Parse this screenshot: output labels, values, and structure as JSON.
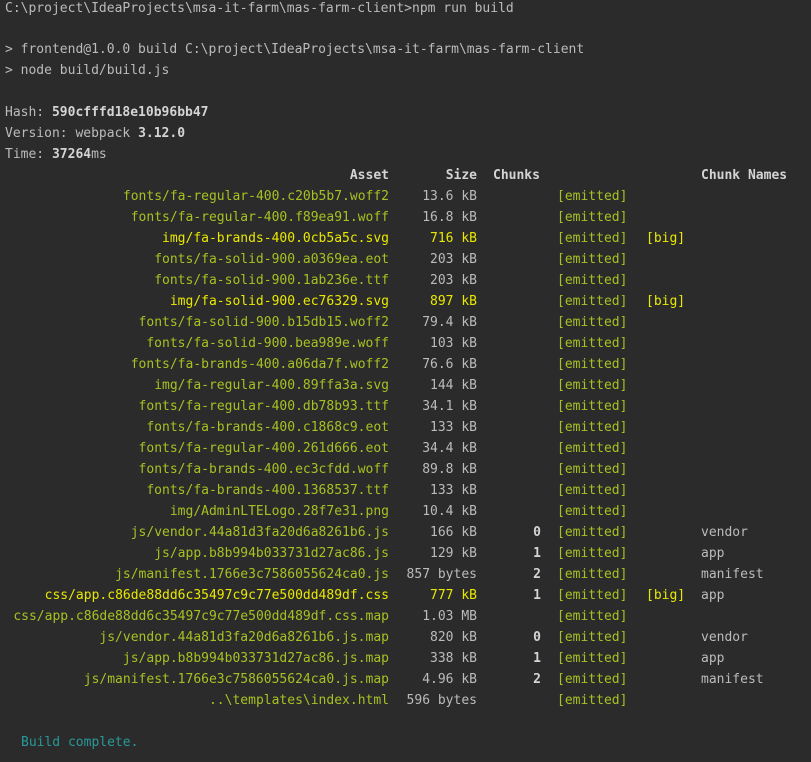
{
  "terminal": {
    "prompt_line": "C:\\project\\IdeaProjects\\msa-it-farm\\mas-farm-client>npm run build",
    "script_line": "> frontend@1.0.0 build C:\\project\\IdeaProjects\\msa-it-farm\\mas-farm-client",
    "node_line": "> node build/build.js",
    "hash_label": "Hash: ",
    "hash_value": "590cfffd18e10b96bb47",
    "version_label": "Version: webpack ",
    "version_value": "3.12.0",
    "time_label": "Time: ",
    "time_value": "37264",
    "time_unit": "ms",
    "build_complete": "Build complete."
  },
  "table": {
    "headers": {
      "asset": "Asset",
      "size": "Size",
      "chunks": "Chunks",
      "chunk_names": "Chunk Names"
    },
    "rows": [
      {
        "asset": "fonts/fa-regular-400.c20b5b7.woff2",
        "size": "13.6 kB",
        "chunks": "",
        "emitted": "[emitted]",
        "big": "",
        "names": "",
        "highlight": false
      },
      {
        "asset": "fonts/fa-regular-400.f89ea91.woff",
        "size": "16.8 kB",
        "chunks": "",
        "emitted": "[emitted]",
        "big": "",
        "names": "",
        "highlight": false
      },
      {
        "asset": "img/fa-brands-400.0cb5a5c.svg",
        "size": "716 kB",
        "chunks": "",
        "emitted": "[emitted]",
        "big": "[big]",
        "names": "",
        "highlight": true
      },
      {
        "asset": "fonts/fa-solid-900.a0369ea.eot",
        "size": "203 kB",
        "chunks": "",
        "emitted": "[emitted]",
        "big": "",
        "names": "",
        "highlight": false
      },
      {
        "asset": "fonts/fa-solid-900.1ab236e.ttf",
        "size": "203 kB",
        "chunks": "",
        "emitted": "[emitted]",
        "big": "",
        "names": "",
        "highlight": false
      },
      {
        "asset": "img/fa-solid-900.ec76329.svg",
        "size": "897 kB",
        "chunks": "",
        "emitted": "[emitted]",
        "big": "[big]",
        "names": "",
        "highlight": true
      },
      {
        "asset": "fonts/fa-solid-900.b15db15.woff2",
        "size": "79.4 kB",
        "chunks": "",
        "emitted": "[emitted]",
        "big": "",
        "names": "",
        "highlight": false
      },
      {
        "asset": "fonts/fa-solid-900.bea989e.woff",
        "size": "103 kB",
        "chunks": "",
        "emitted": "[emitted]",
        "big": "",
        "names": "",
        "highlight": false
      },
      {
        "asset": "fonts/fa-brands-400.a06da7f.woff2",
        "size": "76.6 kB",
        "chunks": "",
        "emitted": "[emitted]",
        "big": "",
        "names": "",
        "highlight": false
      },
      {
        "asset": "img/fa-regular-400.89ffa3a.svg",
        "size": "144 kB",
        "chunks": "",
        "emitted": "[emitted]",
        "big": "",
        "names": "",
        "highlight": false
      },
      {
        "asset": "fonts/fa-regular-400.db78b93.ttf",
        "size": "34.1 kB",
        "chunks": "",
        "emitted": "[emitted]",
        "big": "",
        "names": "",
        "highlight": false
      },
      {
        "asset": "fonts/fa-brands-400.c1868c9.eot",
        "size": "133 kB",
        "chunks": "",
        "emitted": "[emitted]",
        "big": "",
        "names": "",
        "highlight": false
      },
      {
        "asset": "fonts/fa-regular-400.261d666.eot",
        "size": "34.4 kB",
        "chunks": "",
        "emitted": "[emitted]",
        "big": "",
        "names": "",
        "highlight": false
      },
      {
        "asset": "fonts/fa-brands-400.ec3cfdd.woff",
        "size": "89.8 kB",
        "chunks": "",
        "emitted": "[emitted]",
        "big": "",
        "names": "",
        "highlight": false
      },
      {
        "asset": "fonts/fa-brands-400.1368537.ttf",
        "size": "133 kB",
        "chunks": "",
        "emitted": "[emitted]",
        "big": "",
        "names": "",
        "highlight": false
      },
      {
        "asset": "img/AdminLTELogo.28f7e31.png",
        "size": "10.4 kB",
        "chunks": "",
        "emitted": "[emitted]",
        "big": "",
        "names": "",
        "highlight": false
      },
      {
        "asset": "js/vendor.44a81d3fa20d6a8261b6.js",
        "size": "166 kB",
        "chunks": "0",
        "emitted": "[emitted]",
        "big": "",
        "names": "vendor",
        "highlight": false
      },
      {
        "asset": "js/app.b8b994b033731d27ac86.js",
        "size": "129 kB",
        "chunks": "1",
        "emitted": "[emitted]",
        "big": "",
        "names": "app",
        "highlight": false
      },
      {
        "asset": "js/manifest.1766e3c7586055624ca0.js",
        "size": "857 bytes",
        "chunks": "2",
        "emitted": "[emitted]",
        "big": "",
        "names": "manifest",
        "highlight": false
      },
      {
        "asset": "css/app.c86de88dd6c35497c9c77e500dd489df.css",
        "size": "777 kB",
        "chunks": "1",
        "emitted": "[emitted]",
        "big": "[big]",
        "names": "app",
        "highlight": true
      },
      {
        "asset": "css/app.c86de88dd6c35497c9c77e500dd489df.css.map",
        "size": "1.03 MB",
        "chunks": "",
        "emitted": "[emitted]",
        "big": "",
        "names": "",
        "highlight": false
      },
      {
        "asset": "js/vendor.44a81d3fa20d6a8261b6.js.map",
        "size": "820 kB",
        "chunks": "0",
        "emitted": "[emitted]",
        "big": "",
        "names": "vendor",
        "highlight": false
      },
      {
        "asset": "js/app.b8b994b033731d27ac86.js.map",
        "size": "338 kB",
        "chunks": "1",
        "emitted": "[emitted]",
        "big": "",
        "names": "app",
        "highlight": false
      },
      {
        "asset": "js/manifest.1766e3c7586055624ca0.js.map",
        "size": "4.96 kB",
        "chunks": "2",
        "emitted": "[emitted]",
        "big": "",
        "names": "manifest",
        "highlight": false
      },
      {
        "asset": "..\\templates\\index.html",
        "size": "596 bytes",
        "chunks": "",
        "emitted": "[emitted]",
        "big": "",
        "names": "",
        "highlight": false
      }
    ]
  },
  "colors": {
    "background": "#2b2b2b",
    "text": "#bbbbbb",
    "asset_green": "#a8c023",
    "big_yellow": "#e8e800",
    "build_complete": "#299999"
  }
}
